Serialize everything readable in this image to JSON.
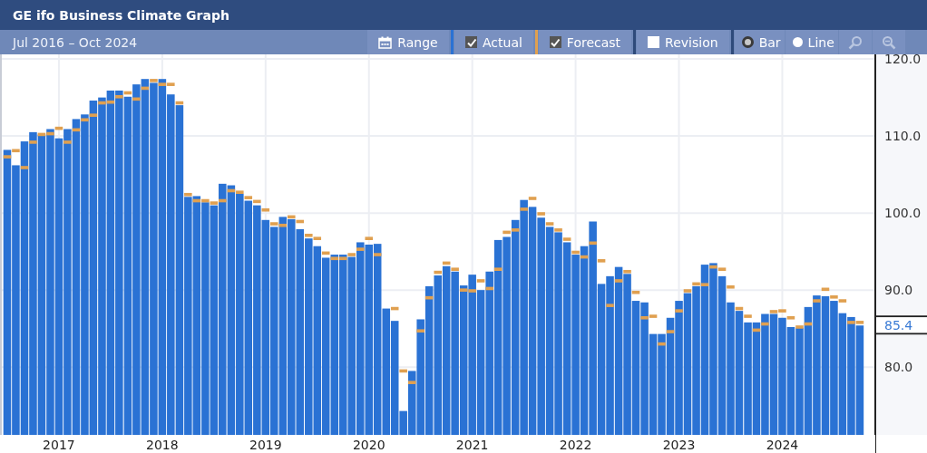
{
  "window": {
    "title": "GE ifo Business Climate Graph"
  },
  "toolbar": {
    "date_range": "Jul 2016 – Oct 2024",
    "range_button": "Range",
    "toggles": [
      {
        "checked": true,
        "color": "#2a72d4"
      },
      {
        "checked": true,
        "color": "#e0a050"
      },
      {
        "label": "Revision",
        "checked": false,
        "color": "#2e4a7a"
      }
    ],
    "chart_types": [
      {
        "label": "Bar",
        "selected": true
      },
      {
        "label": "Line",
        "selected": false
      }
    ]
  },
  "chart": {
    "last_value": "85.4",
    "chart_data": {
      "type": "bar",
      "xlim": [
        2016.43,
        2024.9
      ],
      "grid": true,
      "x": [
        2016.5,
        2016.583,
        2016.667,
        2016.75,
        2016.833,
        2016.917,
        2017,
        2017.083,
        2017.167,
        2017.25,
        2017.333,
        2017.417,
        2017.5,
        2017.583,
        2017.667,
        2017.75,
        2017.833,
        2017.917,
        2018,
        2018.083,
        2018.167,
        2018.25,
        2018.333,
        2018.417,
        2018.5,
        2018.583,
        2018.667,
        2018.75,
        2018.833,
        2018.917,
        2019,
        2019.083,
        2019.167,
        2019.25,
        2019.333,
        2019.417,
        2019.5,
        2019.583,
        2019.667,
        2019.75,
        2019.833,
        2019.917,
        2020,
        2020.083,
        2020.167,
        2020.25,
        2020.333,
        2020.417,
        2020.5,
        2020.583,
        2020.667,
        2020.75,
        2020.833,
        2020.917,
        2021,
        2021.083,
        2021.167,
        2021.25,
        2021.333,
        2021.417,
        2021.5,
        2021.583,
        2021.667,
        2021.75,
        2021.833,
        2021.917,
        2022,
        2022.083,
        2022.167,
        2022.25,
        2022.333,
        2022.417,
        2022.5,
        2022.583,
        2022.667,
        2022.75,
        2022.833,
        2022.917,
        2023,
        2023.083,
        2023.167,
        2023.25,
        2023.333,
        2023.417,
        2023.5,
        2023.583,
        2023.667,
        2023.75,
        2023.833,
        2023.917,
        2024,
        2024.083,
        2024.167,
        2024.25,
        2024.333,
        2024.417,
        2024.5,
        2024.583,
        2024.667,
        2024.75
      ],
      "series": [
        {
          "name": "Actual",
          "color": "#2a72d4",
          "values": [
            108.2,
            106.2,
            109.3,
            110.5,
            110.2,
            110.9,
            109.7,
            110.9,
            112.2,
            112.8,
            114.6,
            115.0,
            115.9,
            115.9,
            115.1,
            116.7,
            117.4,
            116.9,
            117.4,
            115.4,
            114.0,
            102.1,
            102.2,
            101.4,
            101.0,
            103.8,
            103.6,
            102.5,
            101.6,
            101.0,
            99.1,
            98.2,
            99.5,
            99.2,
            97.9,
            96.7,
            95.7,
            94.2,
            94.6,
            94.6,
            94.3,
            96.2,
            95.9,
            96.0,
            87.6,
            86.0,
            74.3,
            79.5,
            86.2,
            90.5,
            91.9,
            93.1,
            92.4,
            90.6,
            92.0,
            90.0,
            92.4,
            96.5,
            96.9,
            99.1,
            101.7,
            100.8,
            99.4,
            98.2,
            97.5,
            96.2,
            94.6,
            95.7,
            98.9,
            90.8,
            91.8,
            93.0,
            92.1,
            88.6,
            88.4,
            84.3,
            84.3,
            86.4,
            88.6,
            89.6,
            90.5,
            93.3,
            93.5,
            91.8,
            88.4,
            87.3,
            85.8,
            85.8,
            86.9,
            86.9,
            86.4,
            85.2,
            85.1,
            87.8,
            89.3,
            89.2,
            88.6,
            87.0,
            86.5,
            85.4
          ]
        },
        {
          "name": "Forecast",
          "type": "scatter",
          "color": "#e0a050",
          "values": [
            107.3,
            108.1,
            105.9,
            109.2,
            110.2,
            110.3,
            111.0,
            109.2,
            110.8,
            112.1,
            112.7,
            114.3,
            114.4,
            115.1,
            115.6,
            114.8,
            116.2,
            117.2,
            116.7,
            116.7,
            114.3,
            102.4,
            101.6,
            101.6,
            101.3,
            101.6,
            102.9,
            102.7,
            102.0,
            101.5,
            100.4,
            98.6,
            98.4,
            99.5,
            98.9,
            97.1,
            96.7,
            94.8,
            94.1,
            94.1,
            94.6,
            95.3,
            96.7,
            94.6,
            null,
            87.6,
            79.5,
            78.0,
            84.7,
            89.0,
            92.3,
            93.5,
            92.7,
            90.0,
            89.9,
            91.2,
            90.2,
            92.7,
            97.5,
            97.8,
            100.5,
            101.9,
            99.9,
            98.6,
            97.8,
            96.6,
            94.9,
            94.3,
            96.1,
            93.8,
            88.0,
            91.2,
            92.4,
            89.7,
            86.4,
            86.6,
            83.0,
            84.6,
            87.3,
            89.9,
            90.8,
            90.7,
            93.0,
            92.7,
            90.4,
            87.6,
            86.6,
            84.8,
            85.6,
            87.2,
            87.3,
            86.4,
            85.2,
            85.6,
            88.6,
            90.1,
            89.1,
            88.6,
            85.8,
            85.8
          ]
        }
      ],
      "ylim": [
        71.2,
        120.6
      ],
      "yticks": [
        {
          "value": 80,
          "label": "80.0"
        },
        {
          "value": 90,
          "label": "90.0"
        },
        {
          "value": 100,
          "label": "100.0"
        },
        {
          "value": 110,
          "label": "110.0"
        },
        {
          "value": 120,
          "label": "120.0"
        }
      ],
      "xticks": [
        2017,
        2018,
        2019,
        2020,
        2021,
        2022,
        2023,
        2024
      ]
    }
  }
}
